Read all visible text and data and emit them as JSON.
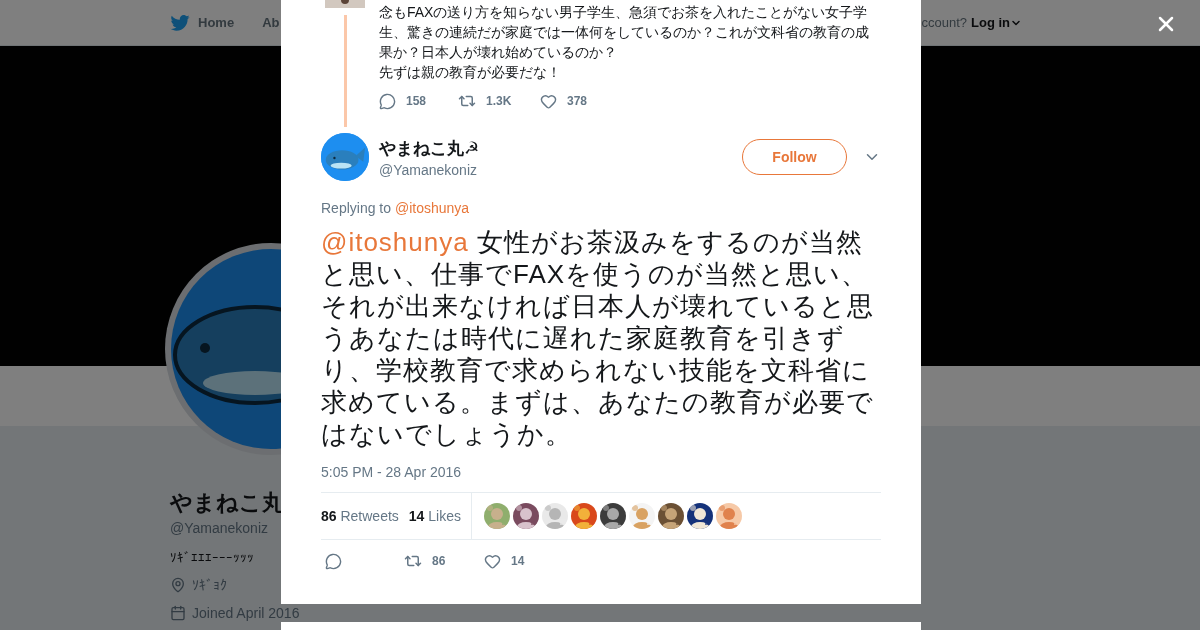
{
  "nav": {
    "items": [
      {
        "label": "Home"
      },
      {
        "label": "Ab"
      }
    ],
    "account_prompt": "ccount?",
    "login": "Log in"
  },
  "profile": {
    "name": "やまねこ丸",
    "handle": "@Yamanekoniz",
    "bio": "ｿｷﾞｴｴｴｰｰｰｯｯｯ",
    "location": "ｿｷﾞｮｸ",
    "joined": "Joined April 2016"
  },
  "parent_tweet": {
    "paragraphs": [
      "念もFAXの送り方を知らない男子学生、急須でお茶を入れたことがない女子学生、驚きの連続だが家庭では一体何をしているのか？これが文科省の教育の成果か？日本人が壊れ始めているのか？",
      "先ずは親の教育が必要だな！"
    ],
    "replies": "158",
    "retweets": "1.3K",
    "likes": "378"
  },
  "tweet": {
    "name": "やまねこ丸☭",
    "handle": "@Yamanekoniz",
    "follow": "Follow",
    "replying_label": "Replying to",
    "replying_to": "@itoshunya",
    "mention": "@itoshunya",
    "text": " 女性がお茶汲みをするのが当然と思い、仕事でFAXを使うのが当然と思い、それが出来なければ日本人が壊れていると思うあなたは時代に遅れた家庭教育を引きずり、学校教育で求められない技能を文科省に求めている。まずは、あなたの教育が必要ではないでしょうか。",
    "timestamp": "5:05 PM - 28 Apr 2016",
    "retweet_count": "86",
    "retweet_label": "Retweets",
    "like_count": "14",
    "like_label": "Likes",
    "action_retweets": "86",
    "action_likes": "14"
  }
}
